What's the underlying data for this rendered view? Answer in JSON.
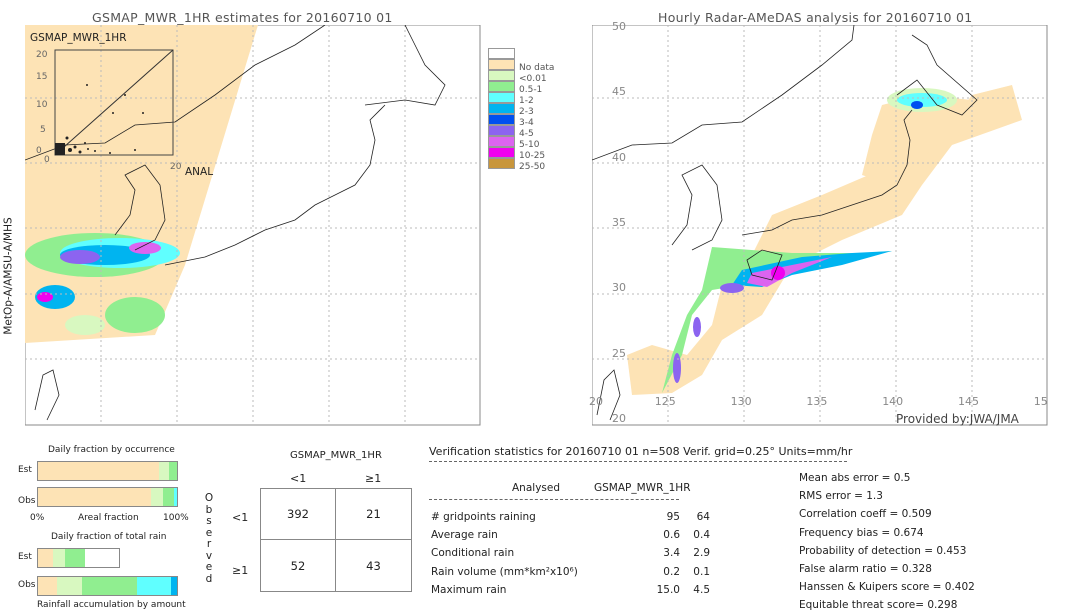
{
  "left_map": {
    "title": "GSMAP_MWR_1HR estimates for 20160710 01",
    "side_label": "MetOp-A/AMSU-A/MHS",
    "inset": {
      "label": "GSMAP_MWR_1HR",
      "x_label": "ANAL",
      "ticks": [
        "0",
        "5",
        "10",
        "15",
        "20"
      ]
    }
  },
  "right_map": {
    "title": "Hourly Radar-AMeDAS analysis for 20160710 01",
    "credit": "Provided by:JWA/JMA",
    "lat_ticks": [
      "50",
      "45",
      "40",
      "35",
      "30",
      "25",
      "20"
    ],
    "lon_ticks": [
      "20",
      "125",
      "130",
      "135",
      "140",
      "145",
      "15"
    ]
  },
  "legend": {
    "items": [
      {
        "label": "",
        "color": "#ffffff"
      },
      {
        "label": "No data",
        "color": "#fde3b5"
      },
      {
        "label": "<0.01",
        "color": "#d8f8c0"
      },
      {
        "label": "0.5-1",
        "color": "#90ee90"
      },
      {
        "label": "1-2",
        "color": "#60ffff"
      },
      {
        "label": "2-3",
        "color": "#00b4f0"
      },
      {
        "label": "3-4",
        "color": "#0050f0"
      },
      {
        "label": "4-5",
        "color": "#8c64f0"
      },
      {
        "label": "5-10",
        "color": "#dc64f0"
      },
      {
        "label": "10-25",
        "color": "#f000f0"
      },
      {
        "label": "25-50",
        "color": "#c8963c"
      }
    ]
  },
  "fraction_occurrence": {
    "title": "Daily fraction by occurrence",
    "est_label": "Est",
    "obs_label": "Obs",
    "axis_left": "0%",
    "axis_mid": "Areal fraction",
    "axis_right": "100%",
    "est": [
      0.87,
      0.07,
      0.06
    ],
    "obs": [
      0.81,
      0.09,
      0.08,
      0.02
    ]
  },
  "fraction_total": {
    "title": "Daily fraction of total rain",
    "est_label": "Est",
    "obs_label": "Obs",
    "footer": "Rainfall accumulation by amount",
    "est": [
      0.18,
      0.16,
      0.24
    ],
    "obs": [
      0.14,
      0.18,
      0.39,
      0.25,
      0.04
    ]
  },
  "contingency": {
    "header": "GSMAP_MWR_1HR",
    "col_labels": [
      "<1",
      "≥1"
    ],
    "row_labels": [
      "<1",
      "≥1"
    ],
    "side_label": [
      "O",
      "b",
      "s",
      "e",
      "r",
      "v",
      "e",
      "d"
    ],
    "cells": [
      [
        "392",
        "21"
      ],
      [
        "52",
        "43"
      ]
    ]
  },
  "stats": {
    "header": "Verification statistics for 20160710 01   n=508   Verif. grid=0.25°   Units=mm/hr",
    "col_analysed": "Analysed",
    "col_est": "GSMAP_MWR_1HR",
    "rows": [
      {
        "label": "# gridpoints raining",
        "analysed": "95",
        "est": "64"
      },
      {
        "label": "Average rain",
        "analysed": "0.6",
        "est": "0.4"
      },
      {
        "label": "Conditional rain",
        "analysed": "3.4",
        "est": "2.9"
      },
      {
        "label": "Rain volume (mm*km²x10⁶)",
        "analysed": "0.2",
        "est": "0.1"
      },
      {
        "label": "Maximum rain",
        "analysed": "15.0",
        "est": "4.5"
      }
    ],
    "scores": [
      "Mean abs error = 0.5",
      "RMS error = 1.3",
      "Correlation coeff = 0.509",
      "Frequency bias = 0.674",
      "Probability of detection = 0.453",
      "False alarm ratio = 0.328",
      "Hanssen & Kuipers score = 0.402",
      "Equitable threat score= 0.298"
    ]
  }
}
